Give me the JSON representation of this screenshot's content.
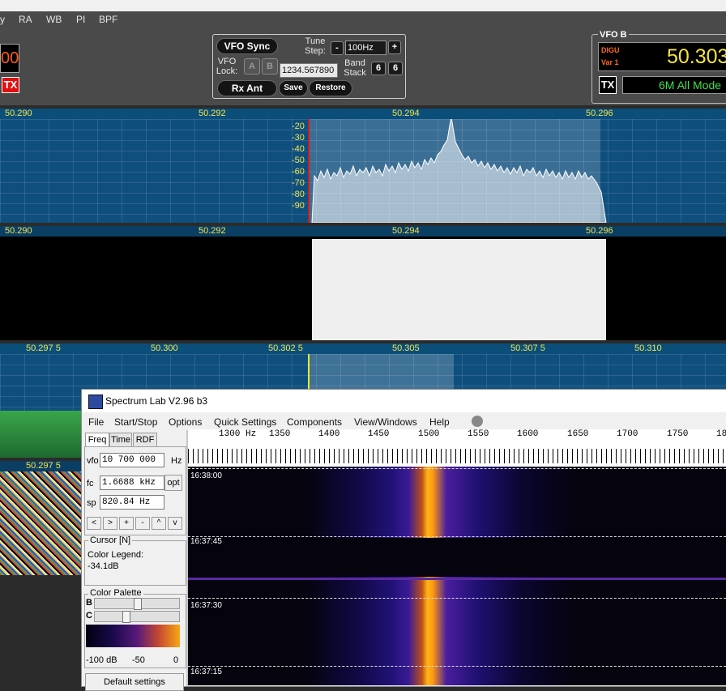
{
  "sdr_menu": {
    "items": [
      "y",
      "RA",
      "WB",
      "PI",
      "BPF"
    ]
  },
  "vfo_a": {
    "freq_partial": "00",
    "tx_label": "TX"
  },
  "vfo_panel": {
    "vfo_sync": "VFO Sync",
    "tune_step_label": "Tune Step:",
    "tune_step_value": "100Hz",
    "minus": "-",
    "plus": "+",
    "vfo_lock_label": "VFO Lock:",
    "btn_a": "A",
    "btn_b": "B",
    "freq_field": "1234.567890",
    "band_stack_label": "Band Stack",
    "band_stack_1": "6",
    "band_stack_2": "6",
    "rx_ant": "Rx Ant",
    "save": "Save",
    "restore": "Restore"
  },
  "vfo_b": {
    "title": "VFO B",
    "mode": "DIGU",
    "var": "Var 1",
    "freq": "50.303",
    "tx_label": "TX",
    "band_label": "6M All Mode"
  },
  "panadapter1": {
    "freq_labels": [
      "50.290",
      "50.292",
      "50.294",
      "50.296"
    ],
    "db_labels": [
      "-20",
      "-30",
      "-40",
      "-50",
      "-60",
      "-70",
      "-80",
      "-90"
    ]
  },
  "panadapter2": {
    "freq_labels": [
      "50.290",
      "50.292",
      "50.294",
      "50.296"
    ]
  },
  "panadapter3": {
    "freq_labels": [
      "50.297 5",
      "50.300",
      "50.302 5",
      "50.305",
      "50.307 5",
      "50.310"
    ]
  },
  "panadapter4": {
    "freq_labels": [
      "50.297 5"
    ]
  },
  "spectrum_lab": {
    "title": "Spectrum Lab V2.96 b3",
    "menu": [
      "File",
      "Start/Stop",
      "Options",
      "Quick Settings",
      "Components",
      "View/Windows",
      "Help"
    ],
    "tabs": [
      "Freq",
      "Time",
      "RDF"
    ],
    "vfo_label": "vfo",
    "vfo_value": "10 700 000",
    "vfo_unit": "Hz",
    "fc_label": "fc",
    "fc_value": "1.6688 kHz",
    "opt_label": "opt",
    "sp_label": "sp",
    "sp_value": "820.84 Hz",
    "nav_buttons": [
      "<",
      ">",
      "+",
      "-",
      "^",
      "v"
    ],
    "cursor_title": "Cursor [N]",
    "color_legend_label": "Color Legend:",
    "color_legend_value": "-34.1dB",
    "palette_title": "Color Palette",
    "b_label": "B",
    "c_label": "C",
    "palette_scale": [
      "-100 dB",
      "-50",
      "0"
    ],
    "default_settings": "Default settings",
    "ruler_labels": [
      "1300 Hz",
      "1350",
      "1400",
      "1450",
      "1500",
      "1550",
      "1600",
      "1650",
      "1700",
      "1750",
      "18"
    ],
    "timestamps": [
      "16:38:00",
      "16:37:45",
      "16:37:30",
      "16:37:15"
    ]
  }
}
